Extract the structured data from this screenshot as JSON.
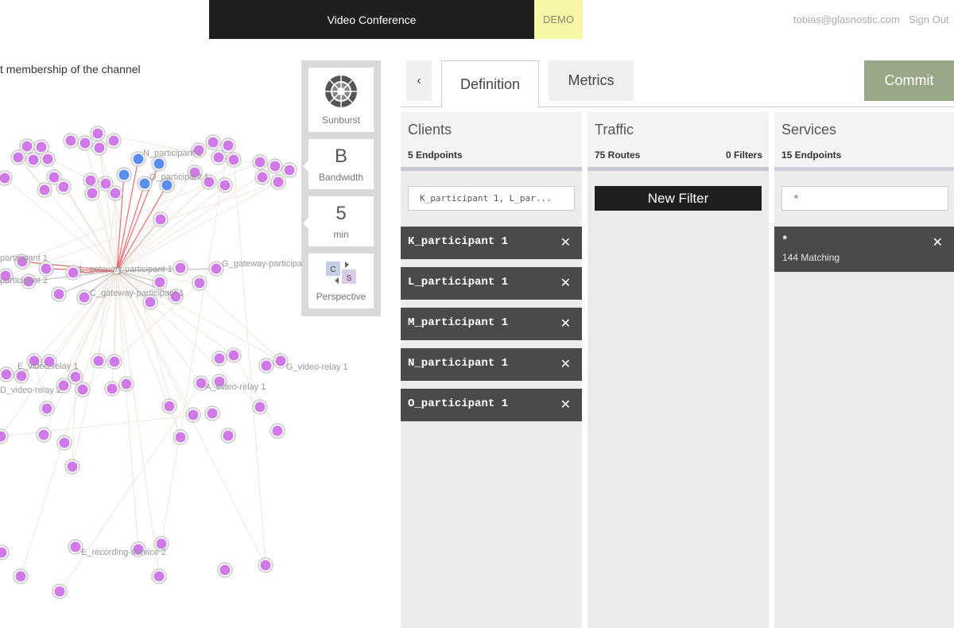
{
  "header": {
    "title": "Video Conference",
    "badge": "DEMO",
    "user_email": "tobias@glasnostic.com",
    "sign_out": "Sign Out"
  },
  "graph": {
    "caption": "t membership of the channel",
    "labels": [
      "N_participant 1",
      "O_participant 1",
      "L_gateway-participant 1",
      "G_gateway-participant",
      "C_gateway-participant 1",
      "participant 1",
      "participant 2",
      "E_video-relay 1",
      "D_video-relay 2",
      "A_video-relay 1",
      "G_video-relay 1",
      "E_recording-service 2"
    ],
    "colors": {
      "node": "#d07ae8",
      "node_ring": "#bdbdbd",
      "highlight": "#5b8dee",
      "link": "#e96d6d"
    }
  },
  "toolbox": {
    "sunburst": {
      "label": "Sunburst",
      "icon": "sunburst-icon"
    },
    "metric": {
      "value": "B",
      "label": "Bandwidth"
    },
    "interval": {
      "value": "5",
      "label": "min"
    },
    "perspective": {
      "label": "Perspective",
      "icon": "perspective-icon",
      "c": "C",
      "s": "S"
    }
  },
  "tabs": {
    "back": "‹",
    "definition": "Definition",
    "metrics": "Metrics",
    "commit": "Commit"
  },
  "clients": {
    "title": "Clients",
    "count": "5 Endpoints",
    "filter_value": "K_participant 1, L_par...",
    "items": [
      {
        "label": "K_participant 1"
      },
      {
        "label": "L_participant 1"
      },
      {
        "label": "M_participant 1"
      },
      {
        "label": "N_participant 1"
      },
      {
        "label": "O_participant 1"
      }
    ],
    "remove": "✕"
  },
  "traffic": {
    "title": "Traffic",
    "routes": "75 Routes",
    "filters": "0 Filters",
    "new_filter": "New Filter"
  },
  "services": {
    "title": "Services",
    "count": "15 Endpoints",
    "filter_value": "*",
    "item": {
      "label": "*",
      "sub": "144 Matching"
    },
    "remove": "✕"
  }
}
